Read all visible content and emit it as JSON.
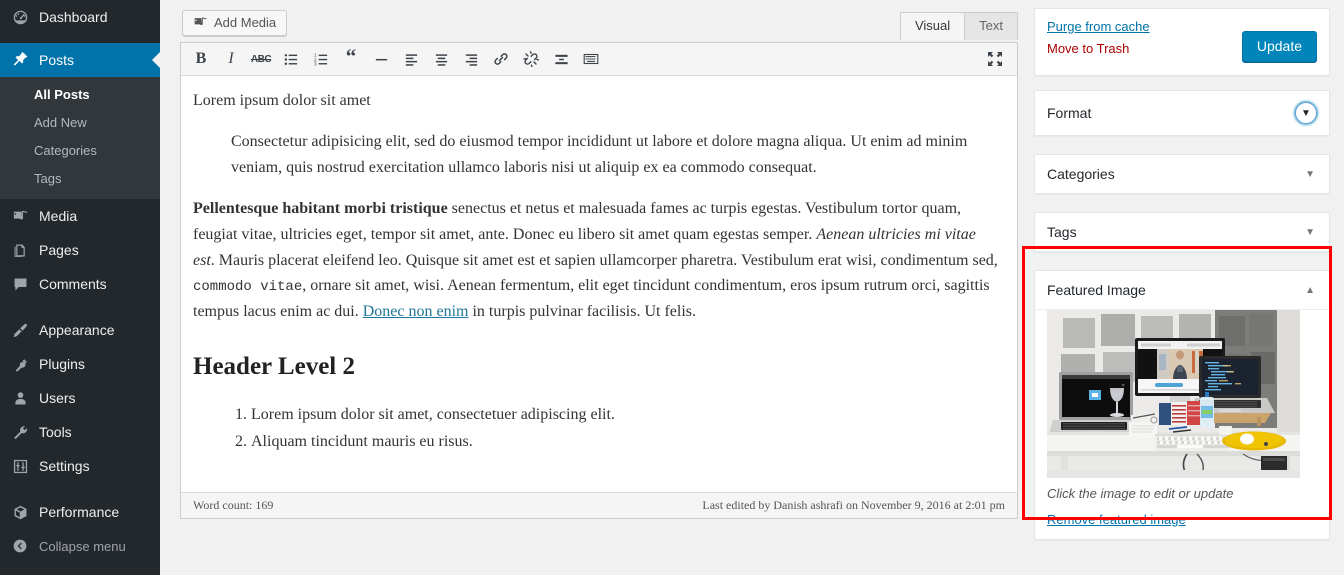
{
  "sidebar": {
    "items": [
      {
        "label": "Dashboard",
        "icon": "dashboard-icon",
        "current": false
      },
      {
        "label": "Posts",
        "icon": "pin-icon",
        "current": true
      },
      {
        "label": "Media",
        "icon": "media-icon",
        "current": false
      },
      {
        "label": "Pages",
        "icon": "pages-icon",
        "current": false
      },
      {
        "label": "Comments",
        "icon": "comments-icon",
        "current": false
      },
      {
        "label": "Appearance",
        "icon": "brush-icon",
        "current": false
      },
      {
        "label": "Plugins",
        "icon": "plug-icon",
        "current": false
      },
      {
        "label": "Users",
        "icon": "user-icon",
        "current": false
      },
      {
        "label": "Tools",
        "icon": "wrench-icon",
        "current": false
      },
      {
        "label": "Settings",
        "icon": "sliders-icon",
        "current": false
      },
      {
        "label": "Performance",
        "icon": "cube-icon",
        "current": false
      }
    ],
    "submenu": [
      {
        "label": "All Posts",
        "current": true
      },
      {
        "label": "Add New",
        "current": false
      },
      {
        "label": "Categories",
        "current": false
      },
      {
        "label": "Tags",
        "current": false
      }
    ],
    "collapse_label": "Collapse menu",
    "collapse_icon": "chevron-left-circle-icon",
    "bg": "#23282d",
    "submenu_bg": "#32373c",
    "current_bg": "#0073aa"
  },
  "editor": {
    "add_media_label": "Add Media",
    "add_media_icon": "media-icon",
    "tabs": [
      {
        "label": "Visual",
        "active": true
      },
      {
        "label": "Text",
        "active": false
      }
    ],
    "fullscreen_icon": "fullscreen-icon",
    "toolbar": [
      {
        "name": "bold-icon",
        "title": "Bold"
      },
      {
        "name": "italic-icon",
        "title": "Italic"
      },
      {
        "name": "strikethrough-icon",
        "title": "Strikethrough"
      },
      {
        "name": "bullet-list-icon",
        "title": "Bulleted list"
      },
      {
        "name": "numbered-list-icon",
        "title": "Numbered list"
      },
      {
        "name": "blockquote-icon",
        "title": "Blockquote"
      },
      {
        "name": "horizontal-rule-icon",
        "title": "Horizontal line"
      },
      {
        "name": "align-left-icon",
        "title": "Align left"
      },
      {
        "name": "align-center-icon",
        "title": "Align center"
      },
      {
        "name": "align-right-icon",
        "title": "Align right"
      },
      {
        "name": "link-icon",
        "title": "Insert link"
      },
      {
        "name": "unlink-icon",
        "title": "Remove link"
      },
      {
        "name": "read-more-icon",
        "title": "Insert Read More tag"
      },
      {
        "name": "keyboard-shortcuts-icon",
        "title": "Keyboard shortcuts"
      }
    ],
    "content": {
      "para1": "Lorem ipsum dolor sit amet",
      "blockquote": "Consectetur adipisicing elit, sed do eiusmod tempor incididunt ut labore et dolore magna aliqua. Ut enim ad minim veniam, quis nostrud exercitation ullamco laboris nisi ut aliquip ex ea commodo consequat.",
      "para2_bold": "Pellentesque habitant morbi tristique",
      "para2_a": " senectus et netus et malesuada fames ac turpis egestas. Vestibulum tortor quam, feugiat vitae, ultricies eget, tempor sit amet, ante. Donec eu libero sit amet quam egestas semper. ",
      "para2_em": "Aenean ultricies mi vitae est",
      "para2_b": ". Mauris placerat eleifend leo. Quisque sit amet est et sapien ullamcorper pharetra. Vestibulum erat wisi, condimentum sed, ",
      "para2_code": "commodo vitae",
      "para2_c": ", ornare sit amet, wisi. Aenean fermentum, elit eget tincidunt condimentum, eros ipsum rutrum orci, sagittis tempus lacus enim ac dui. ",
      "para2_link": "Donec non enim",
      "para2_d": " in turpis pulvinar facilisis. Ut felis.",
      "heading2": "Header Level 2",
      "list": [
        "Lorem ipsum dolor sit amet, consectetuer adipiscing elit.",
        "Aliquam tincidunt mauris eu risus."
      ]
    },
    "status": {
      "word_count": "Word count: 169",
      "last_edited": "Last edited by Danish ashrafi on November 9, 2016 at 2:01 pm"
    }
  },
  "sidebar_right": {
    "purge_label": "Purge from cache",
    "trash_label": "Move to Trash",
    "update_label": "Update",
    "update_color": "#0085ba",
    "boxes": [
      {
        "title": "Format",
        "toggle": "chevron-down-icon",
        "focused": true
      },
      {
        "title": "Categories",
        "toggle": "chevron-down-icon",
        "focused": false
      },
      {
        "title": "Tags",
        "toggle": "chevron-down-icon",
        "focused": false
      }
    ],
    "featured": {
      "title": "Featured Image",
      "toggle": "chevron-up-icon",
      "caption": "Click the image to edit or update",
      "remove_label": "Remove featured image",
      "image_alt": "desk-with-monitor-and-two-laptops-photo",
      "highlight_color": "#ff0000"
    }
  }
}
